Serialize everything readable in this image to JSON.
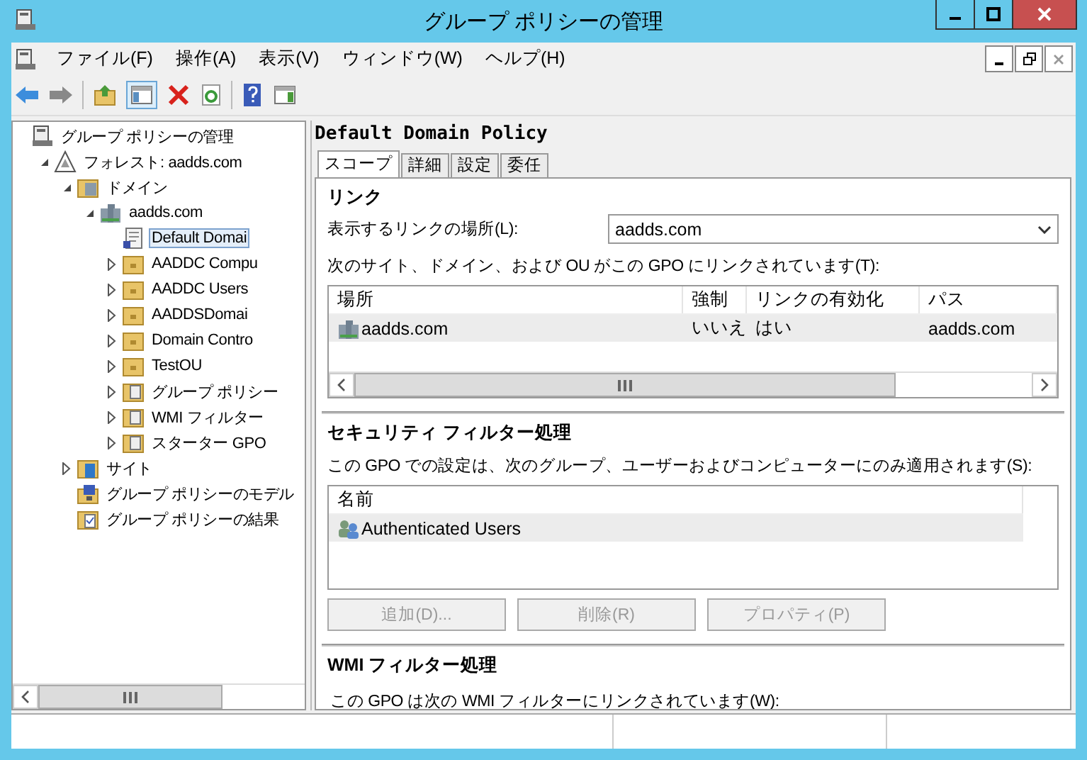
{
  "window": {
    "title": "グループ ポリシーの管理"
  },
  "menu": [
    {
      "label": "ファイル(F)"
    },
    {
      "label": "操作(A)"
    },
    {
      "label": "表示(V)"
    },
    {
      "label": "ウィンドウ(W)"
    },
    {
      "label": "ヘルプ(H)"
    }
  ],
  "tree": [
    {
      "label": "グループ ポリシーの管理",
      "kind": "console",
      "selected": false,
      "children": [
        {
          "label": "フォレスト: aadds.com",
          "kind": "forest",
          "expanded": true,
          "selected": false,
          "children": [
            {
              "label": "ドメイン",
              "kind": "domains",
              "expanded": true,
              "selected": false,
              "children": [
                {
                  "label": "aadds.com",
                  "kind": "domain",
                  "expanded": true,
                  "selected": false,
                  "children": [
                    {
                      "label": "Default Domai",
                      "kind": "gpo",
                      "selected": true
                    },
                    {
                      "label": "AADDC Compu",
                      "kind": "ou",
                      "expanded": false,
                      "selected": false
                    },
                    {
                      "label": "AADDC Users",
                      "kind": "ou",
                      "expanded": false,
                      "selected": false
                    },
                    {
                      "label": "AADDSDomai",
                      "kind": "ou",
                      "expanded": false,
                      "selected": false
                    },
                    {
                      "label": "Domain Contro",
                      "kind": "ou",
                      "expanded": false,
                      "selected": false
                    },
                    {
                      "label": "TestOU",
                      "kind": "ou",
                      "expanded": false,
                      "selected": false
                    },
                    {
                      "label": "グループ ポリシー",
                      "kind": "container",
                      "expanded": false,
                      "selected": false
                    },
                    {
                      "label": "WMI フィルター",
                      "kind": "container",
                      "expanded": false,
                      "selected": false
                    },
                    {
                      "label": "スターター GPO",
                      "kind": "container",
                      "expanded": false,
                      "selected": false
                    }
                  ]
                }
              ]
            },
            {
              "label": "サイト",
              "kind": "site",
              "expanded": false,
              "selected": false
            },
            {
              "label": "グループ ポリシーのモデル",
              "kind": "modeling",
              "selected": false
            },
            {
              "label": "グループ ポリシーの結果",
              "kind": "results",
              "selected": false
            }
          ]
        }
      ]
    }
  ],
  "details": {
    "title": "Default Domain Policy",
    "tabs": [
      {
        "label": "スコープ",
        "selected": true
      },
      {
        "label": "詳細",
        "selected": false
      },
      {
        "label": "設定",
        "selected": false
      },
      {
        "label": "委任",
        "selected": false
      }
    ],
    "links": {
      "heading": "リンク",
      "location_label": "表示するリンクの場所(L):",
      "location_value": "aadds.com",
      "list_label": "次のサイト、ドメイン、および OU がこの GPO にリンクされています(T):",
      "columns": [
        "場所",
        "強制",
        "リンクの有効化",
        "パス"
      ],
      "rows": [
        {
          "cells": [
            "aadds.com",
            "いいえ",
            "はい",
            "aadds.com"
          ],
          "selected": true
        }
      ]
    },
    "security": {
      "heading": "セキュリティ フィルター処理",
      "description": "この GPO での設定は、次のグループ、ユーザーおよびコンピューターにのみ適用されます(S):",
      "columns": [
        "名前"
      ],
      "rows": [
        {
          "name": "Authenticated Users",
          "selected": true
        }
      ],
      "buttons": [
        {
          "label": "追加(D)...",
          "disabled": true
        },
        {
          "label": "削除(R)",
          "disabled": true
        },
        {
          "label": "プロパティ(P)",
          "disabled": true
        }
      ]
    },
    "wmi": {
      "heading": "WMI フィルター処理",
      "description": "この GPO は次の WMI フィルターにリンクされています(W):"
    }
  }
}
